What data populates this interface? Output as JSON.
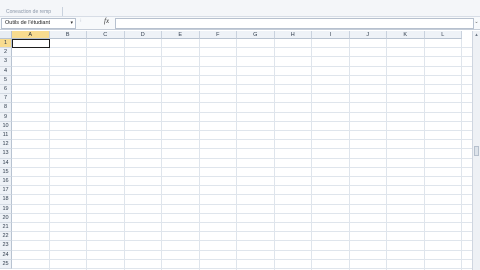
{
  "ribbon": {
    "group_label": "Coneaction de remp"
  },
  "formula_bar": {
    "name_box_value": "Outils de l'étudiant",
    "fx_label": "fx",
    "formula_value": ""
  },
  "sheet": {
    "columns": [
      "A",
      "B",
      "C",
      "D",
      "E",
      "F",
      "G",
      "H",
      "I",
      "J",
      "K",
      "L"
    ],
    "rows": [
      "1",
      "2",
      "3",
      "4",
      "5",
      "6",
      "7",
      "8",
      "9",
      "10",
      "11",
      "12",
      "13",
      "14",
      "15",
      "16",
      "17",
      "18",
      "19",
      "20",
      "21",
      "22",
      "23",
      "24",
      "25"
    ],
    "selected_cell": "A1"
  },
  "colors": {
    "selection_header": "#f8dc8f",
    "gridline": "#dfe5ec"
  }
}
